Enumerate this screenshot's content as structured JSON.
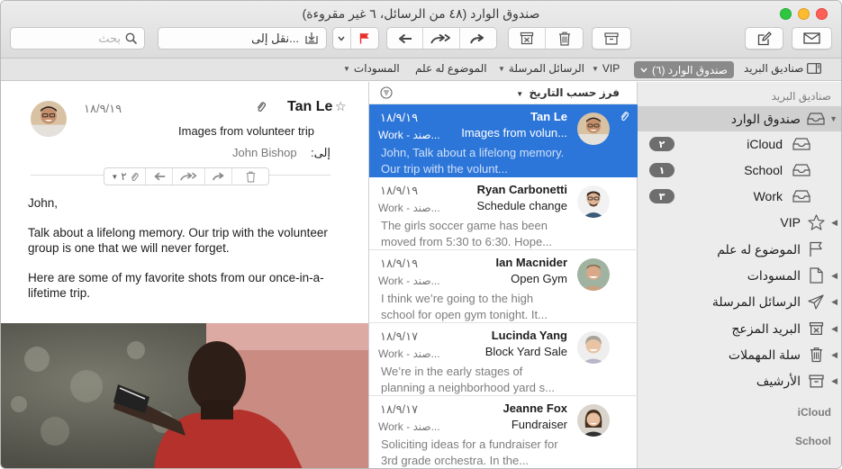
{
  "window": {
    "title": "صندوق الوارد (٤٨ من الرسائل، ٦ غير مقروءة)"
  },
  "toolbar": {
    "search_placeholder": "بحث",
    "move_to_label": "نقل إلى..."
  },
  "favorites": {
    "mailboxes_label": "صناديق البريد",
    "inbox_label": "صندوق الوارد (٦)",
    "vip_label": "VIP",
    "sent_label": "الرسائل المرسلة",
    "flagged_label": "الموضوع له علم",
    "drafts_label": "المسودات"
  },
  "sidebar": {
    "heading": "صناديق البريد",
    "inbox": "صندوق الوارد",
    "accounts": [
      {
        "name": "iCloud",
        "unread": "٢"
      },
      {
        "name": "School",
        "unread": "١"
      },
      {
        "name": "Work",
        "unread": "٣"
      }
    ],
    "items": [
      {
        "label": "VIP",
        "icon": "star-icon"
      },
      {
        "label": "الموضوع له علم",
        "icon": "flag-icon"
      },
      {
        "label": "المسودات",
        "icon": "document-icon"
      },
      {
        "label": "الرسائل المرسلة",
        "icon": "paper-plane-icon"
      },
      {
        "label": "البريد المزعج",
        "icon": "junk-icon"
      },
      {
        "label": "سلة المهملات",
        "icon": "trash-icon"
      },
      {
        "label": "الأرشيف",
        "icon": "archive-icon"
      }
    ],
    "sections": [
      "iCloud",
      "School"
    ]
  },
  "list": {
    "sort_label": "فرز حسب التاريخ",
    "messages": [
      {
        "sender": "Tan Le",
        "date": "١٨/٩/١٩",
        "subject": "Images from volun...",
        "mailbox": "Work - صند...",
        "preview": "John, Talk about a lifelong memory. Our trip with the volunt..."
      },
      {
        "sender": "Ryan Carbonetti",
        "date": "١٨/٩/١٩",
        "subject": "Schedule change",
        "mailbox": "Work - صند...",
        "preview": "The girls soccer game has been moved from 5:30 to 6:30. Hope..."
      },
      {
        "sender": "Ian Macnider",
        "date": "١٨/٩/١٩",
        "subject": "Open Gym",
        "mailbox": "Work - صند...",
        "preview": "I think we’re going to the high school for open gym tonight. It..."
      },
      {
        "sender": "Lucinda Yang",
        "date": "١٨/٩/١٧",
        "subject": "Block Yard Sale",
        "mailbox": "Work - صند...",
        "preview": "We’re in the early stages of planning a neighborhood yard s..."
      },
      {
        "sender": "Jeanne Fox",
        "date": "١٨/٩/١٧",
        "subject": "Fundraiser",
        "mailbox": "Work - صند...",
        "preview": "Soliciting ideas for a fundraiser for 3rd grade orchestra. In the..."
      }
    ]
  },
  "reader": {
    "sender": "Tan Le",
    "date": "١٨/٩/١٩",
    "subject": "Images from volunteer trip",
    "to_label": "إلى:",
    "to": "John Bishop",
    "attachments_count": "٢",
    "body": [
      "John,",
      "Talk about a lifelong memory. Our trip with the volunteer group is one that we will never forget.",
      "Here are some of my favorite shots from our once-in-a-lifetime trip."
    ]
  },
  "colors": {
    "selection": "#2d76d9",
    "flag": "#e8302b",
    "badge": "#6e6e6e"
  }
}
